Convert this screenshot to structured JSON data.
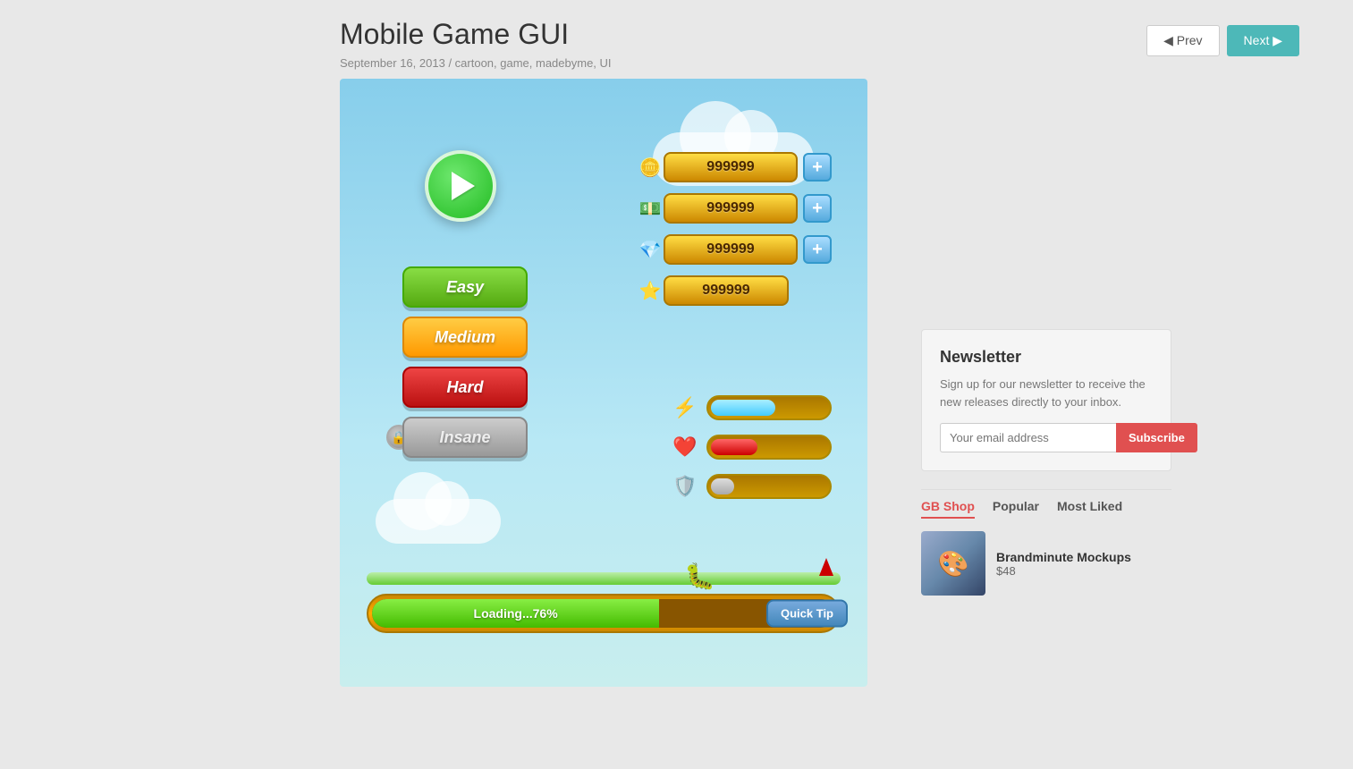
{
  "page": {
    "title": "Mobile Game GUI",
    "meta_date": "September 16, 2013",
    "meta_separator": "/",
    "meta_tags": "cartoon, game, madebyme, UI"
  },
  "nav": {
    "prev_label": "◀ Prev",
    "next_label": "Next ▶"
  },
  "game": {
    "difficulty_buttons": [
      {
        "label": "Easy",
        "class": "easy"
      },
      {
        "label": "Medium",
        "class": "medium"
      },
      {
        "label": "Hard",
        "class": "hard"
      },
      {
        "label": "Insane",
        "class": "insane"
      }
    ],
    "currency": [
      {
        "icon": "🪙",
        "value": "999999",
        "has_plus": true
      },
      {
        "icon": "💵",
        "value": "999999",
        "has_plus": true
      },
      {
        "icon": "💎",
        "value": "999999",
        "has_plus": true
      },
      {
        "icon": "⭐",
        "value": "999999",
        "has_plus": false
      }
    ],
    "progress_bars": [
      {
        "icon": "⚡",
        "fill_class": "lightning",
        "fill_pct": 55
      },
      {
        "icon": "❤️",
        "fill_class": "health",
        "fill_pct": 40
      },
      {
        "icon": "🛡️",
        "fill_class": "shield",
        "fill_pct": 20
      }
    ],
    "loading_text": "Loading...76%",
    "quick_tip_label": "Quick Tip"
  },
  "newsletter": {
    "title": "Newsletter",
    "description": "Sign up for our newsletter to receive the new releases directly to your inbox.",
    "input_placeholder": "Your email address",
    "subscribe_label": "Subscribe"
  },
  "shop_tabs": [
    {
      "label": "GB Shop",
      "active": true
    },
    {
      "label": "Popular",
      "active": false
    },
    {
      "label": "Most Liked",
      "active": false
    }
  ],
  "shop_items": [
    {
      "name": "Brandminute Mockups",
      "price": "$48",
      "thumb_emoji": "🎨"
    }
  ]
}
